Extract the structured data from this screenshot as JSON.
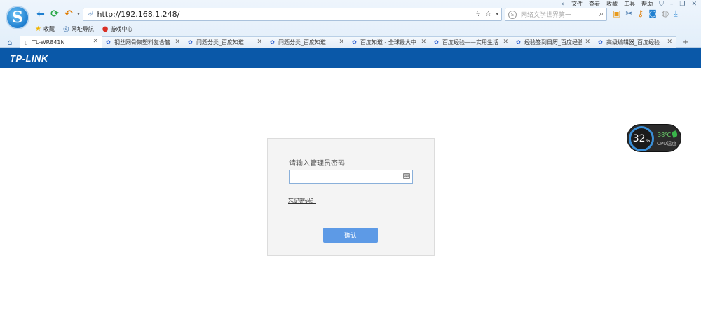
{
  "browser": {
    "menu": [
      "文件",
      "查看",
      "收藏",
      "工具",
      "帮助"
    ],
    "url": "http://192.168.1.248/",
    "search_placeholder": "网络文学世界第一",
    "bookmarks": [
      "收藏",
      "网址导航",
      "游戏中心"
    ],
    "tabs": [
      {
        "title": "TL-WR841N",
        "active": true
      },
      {
        "title": "钢丝网骨架塑料复合管"
      },
      {
        "title": "问题分类_百度知道"
      },
      {
        "title": "问题分类_百度知道"
      },
      {
        "title": "百度知道 - 全球最大中"
      },
      {
        "title": "百度经验——实用生活"
      },
      {
        "title": "经验签到日历_百度经验"
      },
      {
        "title": "高级编辑器_百度经验"
      }
    ],
    "accent_color": "#0a58a8"
  },
  "page": {
    "brand": "TP-LINK",
    "login": {
      "label": "请输入管理员密码",
      "password_value": "",
      "forgot_link": "忘记密码？",
      "submit_label": "确认"
    }
  },
  "cpu_widget": {
    "usage": "32",
    "usage_unit": "%",
    "temperature": "38℃",
    "label": "CPU温度"
  }
}
